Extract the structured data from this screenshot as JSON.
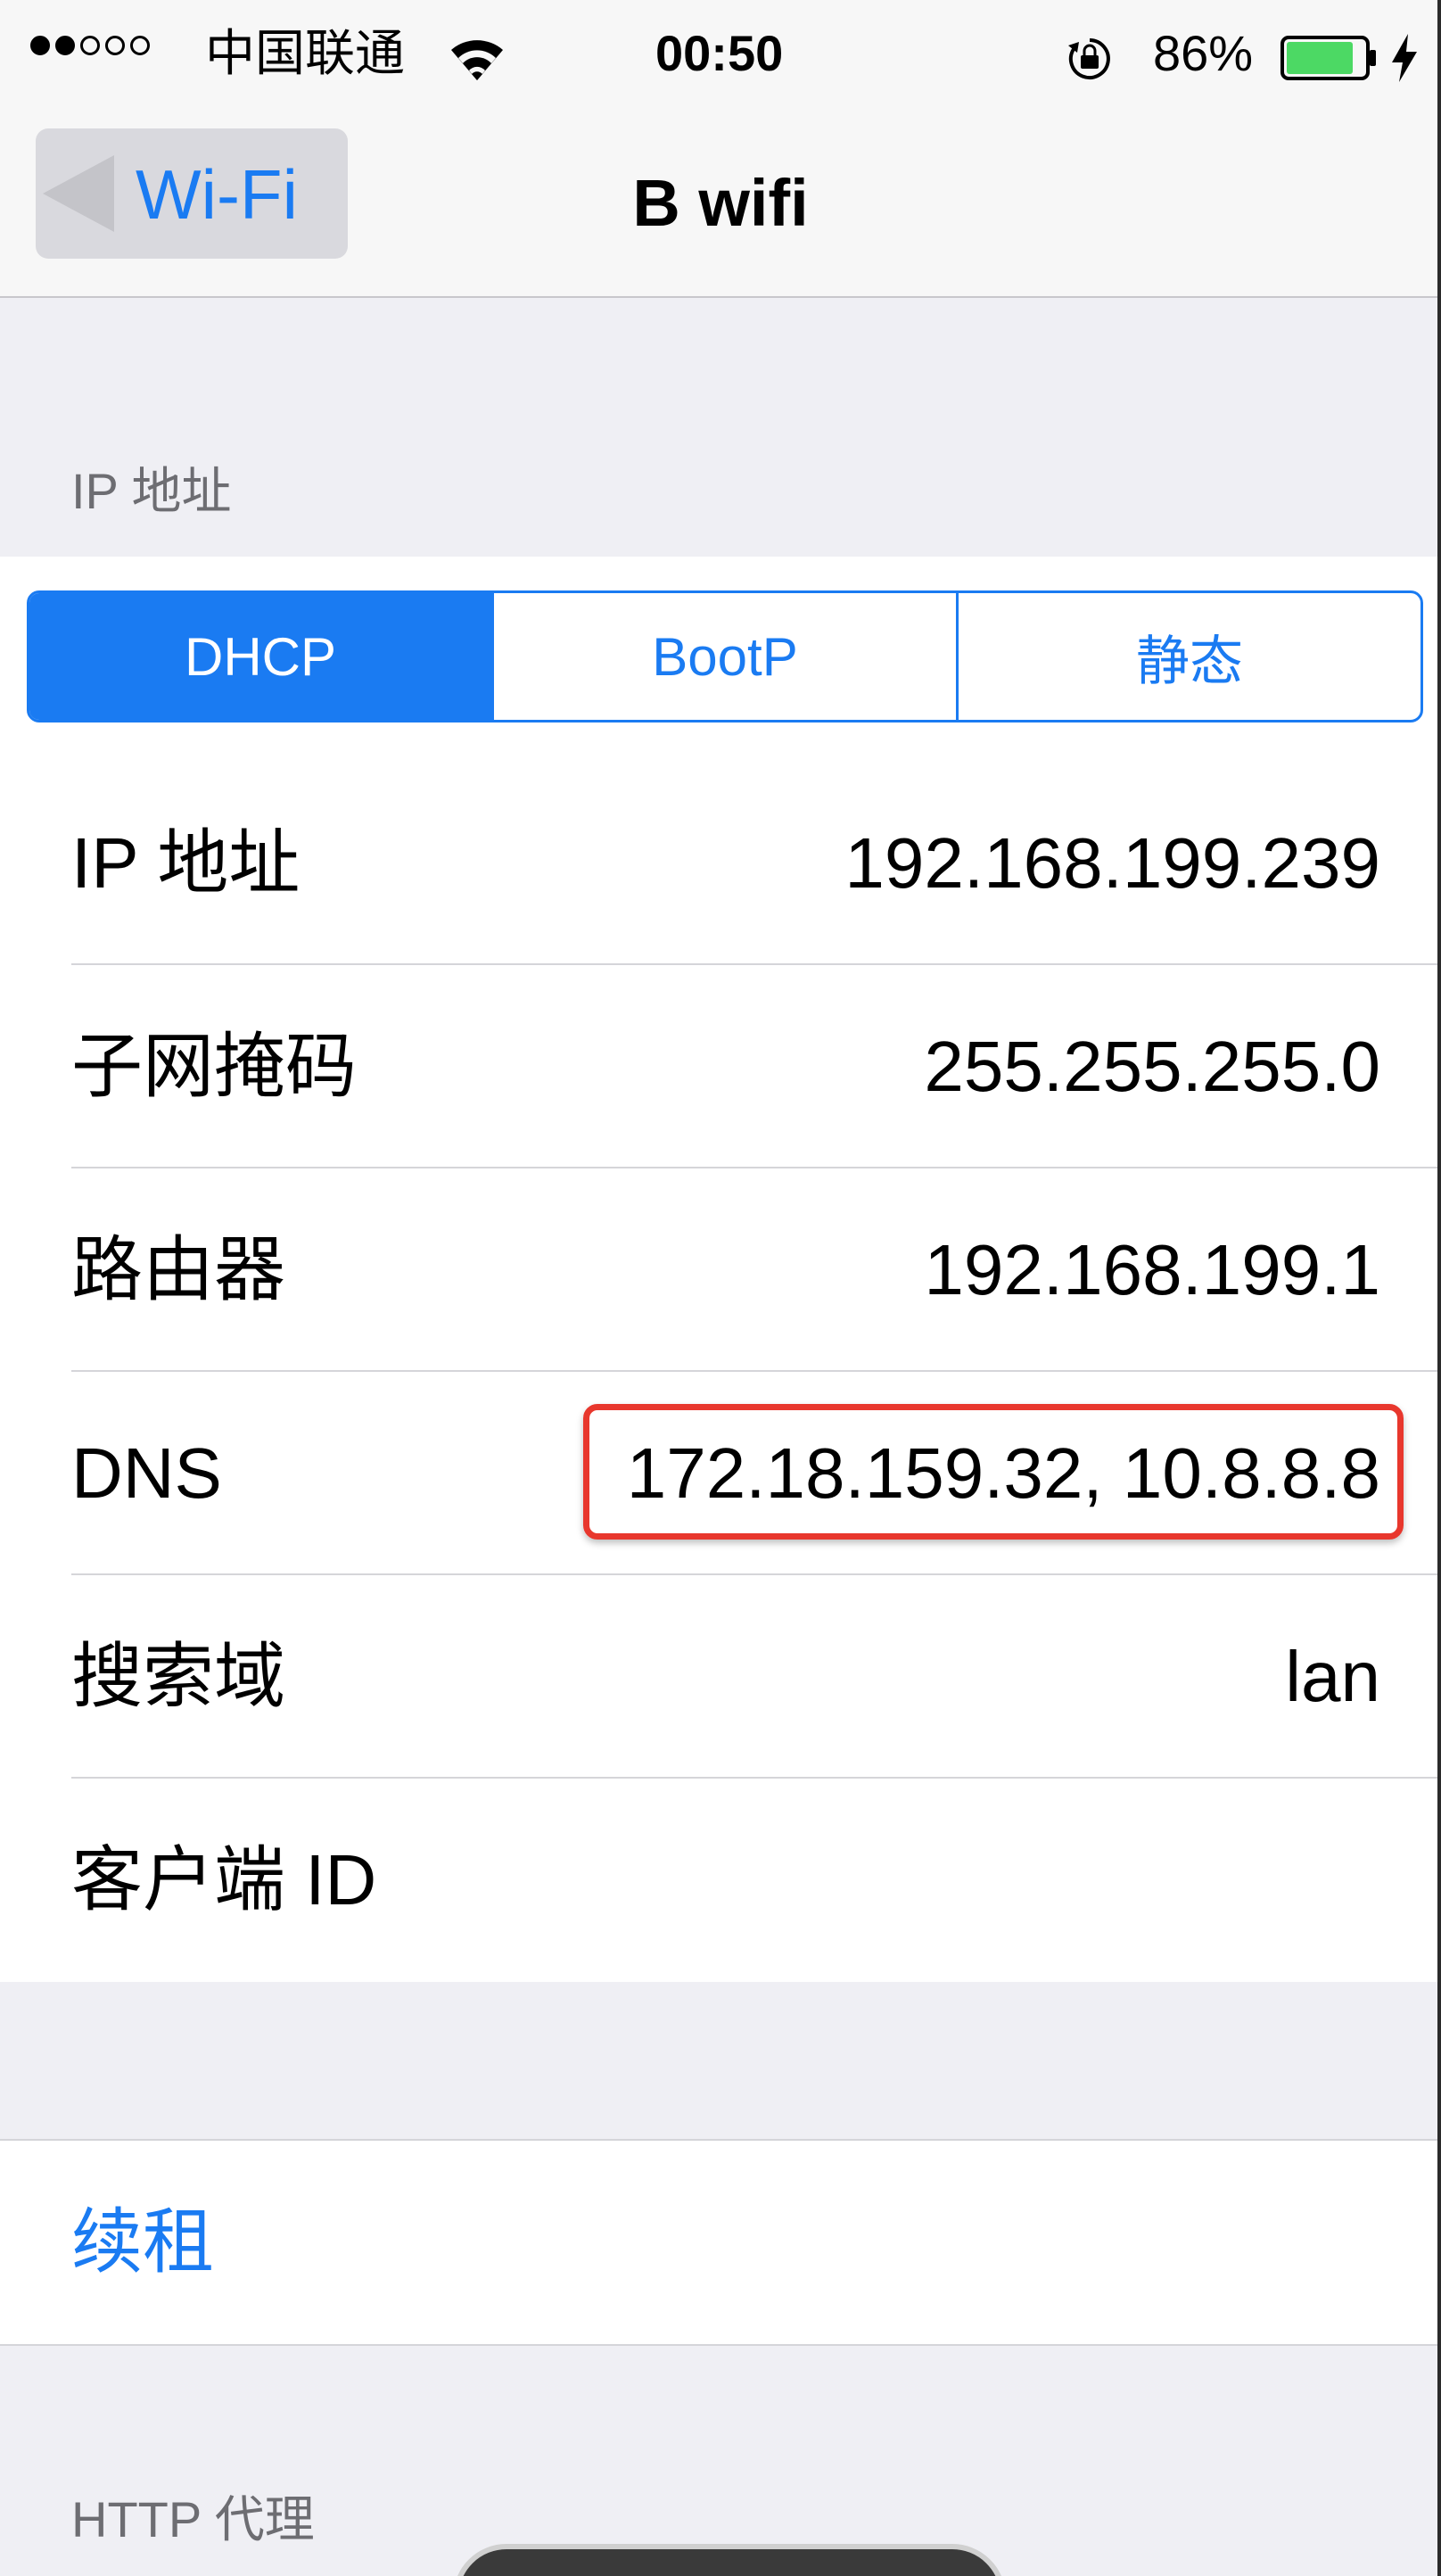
{
  "status_bar": {
    "signal_filled": 2,
    "signal_total": 5,
    "carrier": "中国联通",
    "time": "00:50",
    "battery_percent": "86%",
    "battery_level": 0.86,
    "icons": [
      "wifi-icon",
      "orientation-lock-icon",
      "battery-icon",
      "charging-icon"
    ],
    "battery_color": "#4cd964"
  },
  "nav": {
    "back_label": "Wi-Fi",
    "title": "B wifi"
  },
  "ip_section": {
    "header": "IP 地址",
    "segments": [
      "DHCP",
      "BootP",
      "静态"
    ],
    "selected_segment": "DHCP"
  },
  "rows": [
    {
      "label": "IP 地址",
      "value": "192.168.199.239"
    },
    {
      "label": "子网掩码",
      "value": "255.255.255.0"
    },
    {
      "label": "路由器",
      "value": "192.168.199.1"
    },
    {
      "label": "DNS",
      "value": "172.18.159.32, 10.8.8.8"
    },
    {
      "label": "搜索域",
      "value": "lan"
    },
    {
      "label": "客户端 ID",
      "value": ""
    }
  ],
  "renew_label": "续租",
  "http_proxy_header": "HTTP 代理",
  "colors": {
    "accent": "#1a7bf2",
    "highlight": "#e8372d",
    "background": "#efeff4"
  }
}
